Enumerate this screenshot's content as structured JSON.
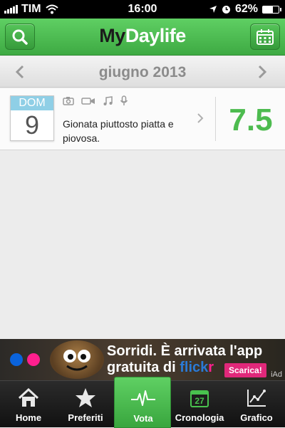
{
  "status_bar": {
    "carrier": "TIM",
    "time": "16:00",
    "battery": "62%",
    "battery_level": 0.62
  },
  "header": {
    "title_part1": "My",
    "title_part2": "Daylife"
  },
  "month_nav": {
    "label": "giugno 2013"
  },
  "entry": {
    "weekday": "DOM",
    "day": "9",
    "text": "Gionata piuttosto piatta e piovosa.",
    "score": "7.5",
    "media_icons": [
      "camera-icon",
      "video-icon",
      "music-icon",
      "microphone-icon"
    ]
  },
  "ad": {
    "line1": "Sorridi. È arrivata l'app",
    "line2_prefix": "gratuita di ",
    "brand_part1": "flick",
    "brand_part2": "r",
    "cta": "Scarica!",
    "badge": "iAd"
  },
  "tabs": [
    {
      "label": "Home",
      "icon": "home-icon"
    },
    {
      "label": "Preferiti",
      "icon": "star-icon"
    },
    {
      "label": "Vota",
      "icon": "heartbeat-icon",
      "active": true
    },
    {
      "label": "Cronologia",
      "icon": "calendar-icon",
      "icon_text": "27"
    },
    {
      "label": "Grafico",
      "icon": "chart-icon"
    }
  ],
  "colors": {
    "accent": "#4dbb4f",
    "header": "#45b249",
    "calendar_day": "#8fcfe6",
    "ad_cta": "#e1287a"
  }
}
